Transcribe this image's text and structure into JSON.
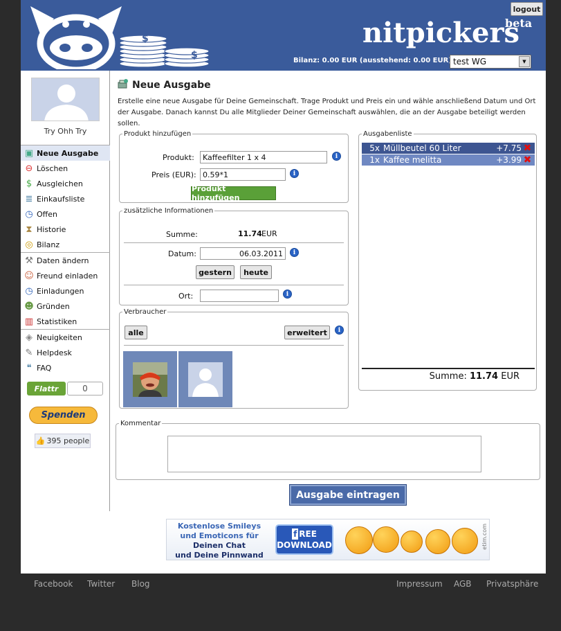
{
  "header": {
    "brand": "nitpickers",
    "beta": "beta",
    "logout_label": "logout",
    "balance_text": "Bilanz: 0.00 EUR (ausstehend: 0.00 EUR)",
    "wg_selected": "test WG"
  },
  "sidebar": {
    "username": "Try Ohh Try",
    "groups": [
      [
        {
          "label": "Neue Ausgabe",
          "icon": "new-expense-icon",
          "active": true
        },
        {
          "label": "Löschen",
          "icon": "delete-icon"
        },
        {
          "label": "Ausgleichen",
          "icon": "money-icon"
        },
        {
          "label": "Einkaufsliste",
          "icon": "list-icon"
        },
        {
          "label": "Offen",
          "icon": "clock-icon"
        },
        {
          "label": "Historie",
          "icon": "hourglass-icon"
        },
        {
          "label": "Bilanz",
          "icon": "coins-icon"
        }
      ],
      [
        {
          "label": "Daten ändern",
          "icon": "wrench-icon"
        },
        {
          "label": "Freund einladen",
          "icon": "add-user-icon"
        },
        {
          "label": "Einladungen",
          "icon": "clock-icon"
        },
        {
          "label": "Gründen",
          "icon": "group-icon"
        },
        {
          "label": "Statistiken",
          "icon": "bar-chart-icon"
        }
      ],
      [
        {
          "label": "Neuigkeiten",
          "icon": "tag-icon"
        },
        {
          "label": "Helpdesk",
          "icon": "notepad-icon"
        },
        {
          "label": "FAQ",
          "icon": "speech-bubble-icon"
        }
      ]
    ],
    "flattr_label": "Flattr",
    "flattr_count": "0",
    "spenden_label": "Spenden",
    "like_count": "395 people"
  },
  "main": {
    "title": "Neue Ausgabe",
    "description": "Erstelle eine neue Ausgabe für Deine Gemeinschaft. Trage Produkt und Preis ein und wähle anschließend Datum und Ort der Ausgabe. Danach kannst Du alle Mitglieder Deiner Gemeinschaft auswählen, die an der Ausgabe beteiligt werden sollen.",
    "produkt": {
      "legend": "Produkt hinzufügen",
      "product_label": "Produkt:",
      "product_value": "Kaffeefilter 1 x 4",
      "price_label": "Preis (EUR):",
      "price_value": "0.59*1",
      "add_button": "Produkt hinzufügen"
    },
    "info": {
      "legend": "zusätzliche Informationen",
      "sum_label": "Summe:",
      "sum_value": "11.74",
      "sum_unit": "EUR",
      "date_label": "Datum:",
      "date_value": "06.03.2011",
      "yesterday_button": "gestern",
      "today_button": "heute",
      "place_label": "Ort:",
      "place_value": ""
    },
    "verbraucher": {
      "legend": "Verbraucher",
      "all_button": "alle",
      "extended_button": "erweitert"
    },
    "liste": {
      "legend": "Ausgabenliste",
      "items": [
        {
          "qty": "5x",
          "name": "Müllbeutel 60 Liter",
          "amount": "+7.75"
        },
        {
          "qty": "1x",
          "name": "Kaffee melitta",
          "amount": "+3.99"
        }
      ],
      "sum_label": "Summe:",
      "sum_value": "11.74",
      "sum_unit": "EUR"
    },
    "kommentar": {
      "legend": "Kommentar",
      "value": ""
    },
    "submit_label": "Ausgabe eintragen"
  },
  "banner": {
    "line1": "Kostenlose Smileys",
    "line2": "und Emoticons für",
    "line3": "Deinen Chat",
    "line4": "und Deine Pinnwand",
    "dl_free": "REE",
    "dl_f": "f",
    "dl_download": "DOWNLOAD",
    "etim": "etim.com"
  },
  "footer": {
    "facebook": "Facebook",
    "twitter": "Twitter",
    "blog": "Blog",
    "impressum": "Impressum",
    "agb": "AGB",
    "privacy": "Privatsphäre"
  },
  "colors": {
    "header_blue": "#3a5b9b",
    "row_dark": "#3d5591",
    "row_light": "#6f88c2",
    "green_button": "#5aa038"
  }
}
